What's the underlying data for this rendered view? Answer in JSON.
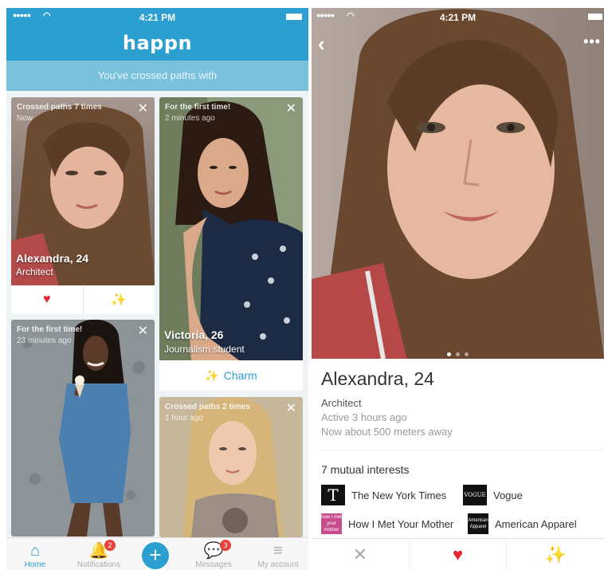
{
  "colors": {
    "brand": "#2a9fd0",
    "subbar": "#7ac2dc",
    "heart": "#e8242f",
    "badge": "#e8423c"
  },
  "left": {
    "status": {
      "time": "4:21 PM"
    },
    "app_title": "happn",
    "subtitle": "You've crossed paths with",
    "cards": [
      {
        "line1": "Crossed paths 7 times",
        "line2": "Now",
        "name": "Alexandra, 24",
        "job": "Architect"
      },
      {
        "line1": "For the first time!",
        "line2": "2 minutes ago",
        "name": "Victoria, 26",
        "job": "Journalism student",
        "charm": "Charm"
      },
      {
        "line1": "For the first time!",
        "line2": "23 minutes ago"
      },
      {
        "line1": "Crossed paths 2 times",
        "line2": "1 hour ago"
      }
    ],
    "tabs": [
      {
        "label": "Home",
        "icon": "home-icon"
      },
      {
        "label": "Notifications",
        "icon": "bell-icon",
        "badge": "2"
      },
      {
        "label": "",
        "icon": "plus-icon"
      },
      {
        "label": "Messages",
        "icon": "chat-icon",
        "badge": "3"
      },
      {
        "label": "My account",
        "icon": "menu-icon"
      }
    ]
  },
  "right": {
    "status": {
      "time": "4:21 PM"
    },
    "profile": {
      "name": "Alexandra, 24",
      "job": "Architect",
      "active": "Active 3 hours ago",
      "distance": "Now about 500 meters away"
    },
    "mutual_title": "7 mutual interests",
    "interests": [
      {
        "name": "The New York Times",
        "logo": "T"
      },
      {
        "name": "Vogue",
        "logo": "VOGUE"
      },
      {
        "name": "How I Met Your Mother",
        "logo": "how i met your mother"
      },
      {
        "name": "American Apparel",
        "logo": "American Apparel"
      }
    ]
  }
}
